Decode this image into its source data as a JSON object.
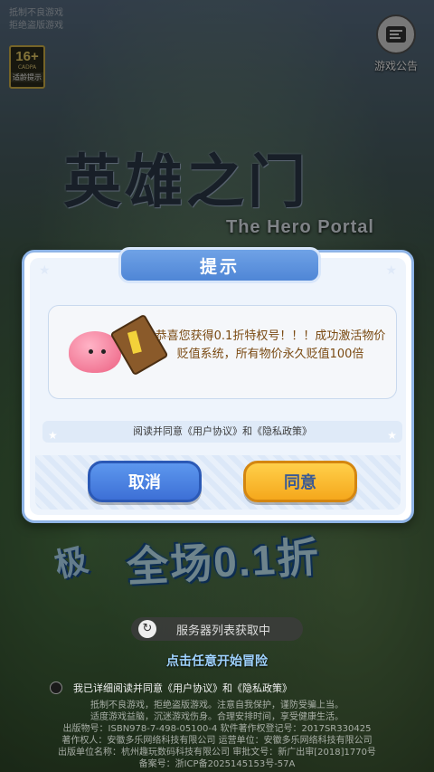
{
  "top_left": {
    "line1": "抵制不良游戏",
    "line2": "拒绝盗版游戏"
  },
  "age_badge": {
    "age": "16+",
    "cadpa": "CADPA",
    "tip": "适龄提示"
  },
  "notice": {
    "label": "游戏公告",
    "icon": "notice-icon"
  },
  "logo": {
    "title": "英雄之门",
    "subtitle": "The Hero Portal"
  },
  "promo": {
    "prefix": "极",
    "text": "全场0.1折"
  },
  "server": {
    "status": "服务器列表获取中"
  },
  "start_hint": "点击任意开始冒险",
  "agree_line": "我已详细阅读并同意《用户协议》和《隐私政策》",
  "footer": [
    "抵制不良游戏，拒绝盗版游戏。注意自我保护，谨防受骗上当。",
    "适度游戏益脑，沉迷游戏伤身。合理安排时间，享受健康生活。",
    "出版物号：ISBN978-7-498-05100-4 软件著作权登记号：2017SR330425",
    "著作权人：安徽多乐网络科技有限公司 运营单位：安徽多乐网络科技有限公司",
    "出版单位名称：杭州趣玩数码科技有限公司 审批文号：新广出审[2018]1770号",
    "备案号：浙ICP备2025145153号-57A"
  ],
  "modal": {
    "title": "提示",
    "message": "恭喜您获得0.1折特权号！！！成功激活物价贬值系统，所有物价永久贬值100倍",
    "agreement": "阅读并同意《用户协议》和《隐私政策》",
    "cancel_label": "取消",
    "confirm_label": "同意"
  },
  "colors": {
    "modal_border": "#8fb4e6",
    "title_blue": "#4f86d6",
    "cancel_blue": "#3d70d6",
    "confirm_yellow": "#f5a81c",
    "message_brown": "#7a4a12"
  }
}
